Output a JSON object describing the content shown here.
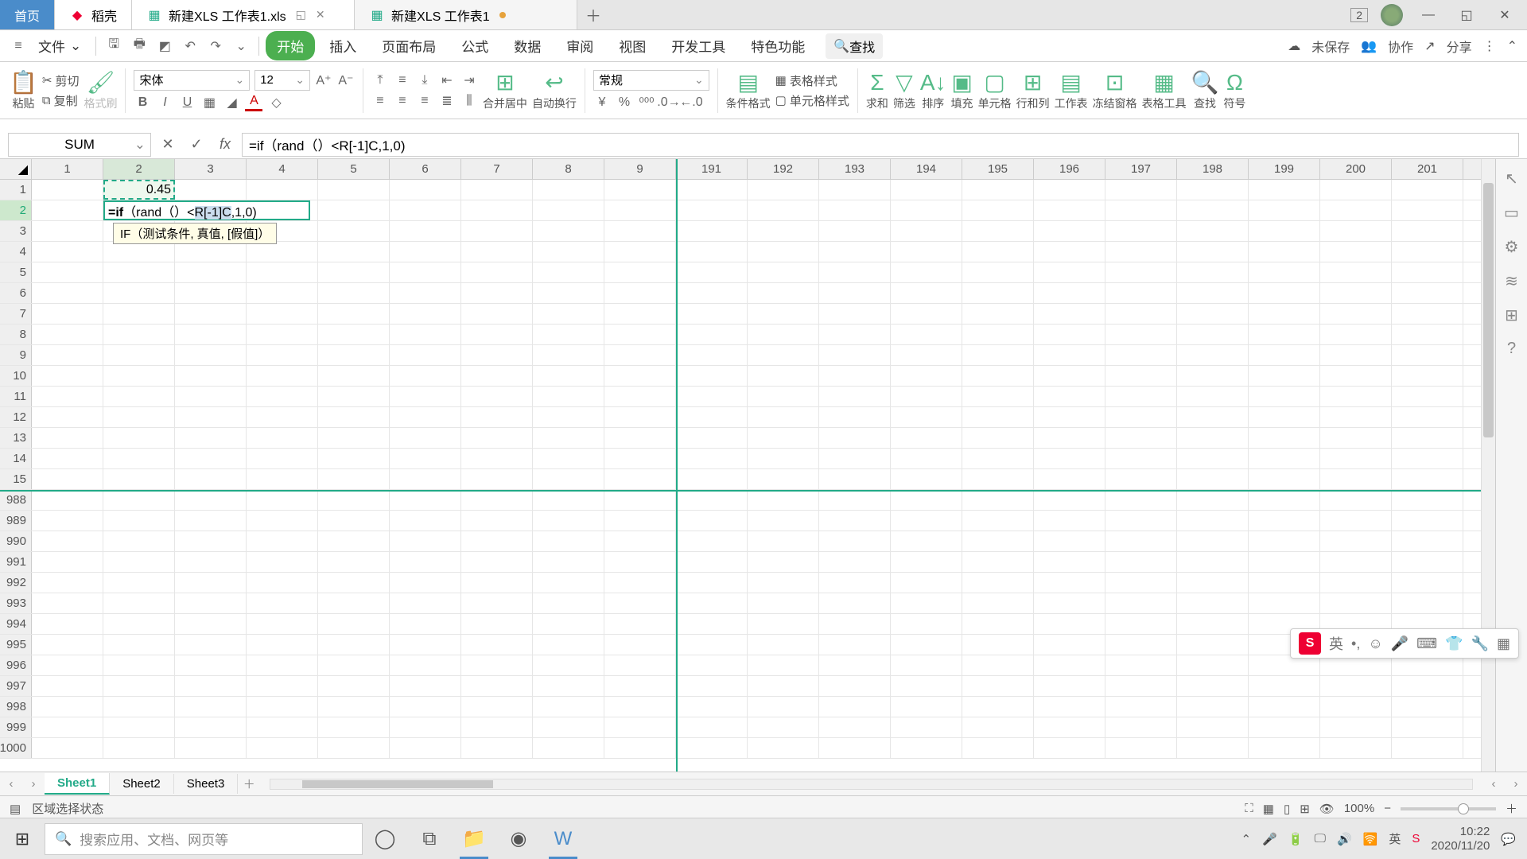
{
  "titlebar": {
    "home": "首页",
    "shell": "稻壳",
    "file1": "新建XLS 工作表1.xls",
    "file2": "新建XLS 工作表1",
    "badge": "2"
  },
  "menu": {
    "file": "文件",
    "tabs": [
      "开始",
      "插入",
      "页面布局",
      "公式",
      "数据",
      "审阅",
      "视图",
      "开发工具",
      "特色功能"
    ],
    "search": "查找",
    "unsaved": "未保存",
    "collab": "协作",
    "share": "分享"
  },
  "ribbon": {
    "paste": "粘贴",
    "cut": "剪切",
    "copy": "复制",
    "fmtpaint": "格式刷",
    "font": "宋体",
    "fontsize": "12",
    "merge": "合并居中",
    "wrap": "自动换行",
    "numfmt": "常规",
    "condfmt": "条件格式",
    "tablestyle": "表格样式",
    "cellstyle": "单元格样式",
    "sum": "求和",
    "filter": "筛选",
    "sort": "排序",
    "fill": "填充",
    "cell": "单元格",
    "rowcol": "行和列",
    "sheet": "工作表",
    "freeze": "冻结窗格",
    "tabletool": "表格工具",
    "find": "查找",
    "symbol": "符号"
  },
  "formulabar": {
    "name": "SUM",
    "formula": "=if（rand（）<R[-1]C,1,0)"
  },
  "grid": {
    "cols_top": [
      "1",
      "2",
      "3",
      "4",
      "5",
      "6",
      "7",
      "8",
      "9"
    ],
    "cols_right": [
      "191",
      "192",
      "193",
      "194",
      "195",
      "196",
      "197",
      "198",
      "199",
      "200",
      "201"
    ],
    "rows_top": [
      "1",
      "2",
      "3",
      "4",
      "5",
      "6",
      "7",
      "8",
      "9",
      "10",
      "11",
      "12",
      "13",
      "14",
      "15"
    ],
    "rows_bottom": [
      "988",
      "989",
      "990",
      "991",
      "992",
      "993",
      "994",
      "995",
      "996",
      "997",
      "998",
      "999",
      "1000"
    ],
    "ref_value": "0.45",
    "edit_value": "=if（rand（）<R[-1]C,1,0)",
    "tooltip": "IF（测试条件, 真值, [假值]）"
  },
  "sheets": {
    "tabs": [
      "Sheet1",
      "Sheet2",
      "Sheet3"
    ]
  },
  "status": {
    "mode": "区域选择状态",
    "zoom": "100%"
  },
  "ime": {
    "lang": "英"
  },
  "taskbar": {
    "search_ph": "搜索应用、文档、网页等",
    "time": "10:22",
    "date": "2020/11/20",
    "lang": "英"
  }
}
